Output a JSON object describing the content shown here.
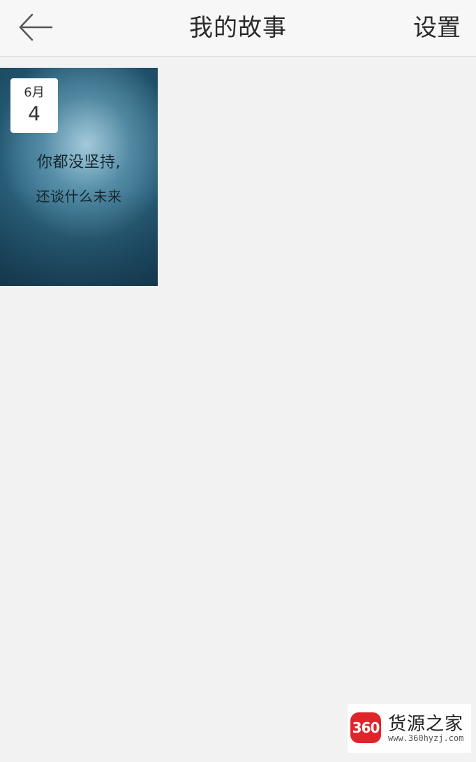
{
  "header": {
    "title": "我的故事",
    "settings_label": "设置",
    "back_icon": "arrow-left-icon"
  },
  "stories": [
    {
      "date": {
        "month": "6月",
        "day": "4"
      },
      "text_lines": [
        "你都没坚持,",
        "还谈什么未来"
      ]
    }
  ],
  "watermark": {
    "logo_text": "360",
    "title": "货源之家",
    "url": "www.360hyzj.com"
  },
  "colors": {
    "page_bg": "#f2f2f2",
    "header_bg": "#f7f7f7",
    "logo_red": "#e0242b"
  }
}
